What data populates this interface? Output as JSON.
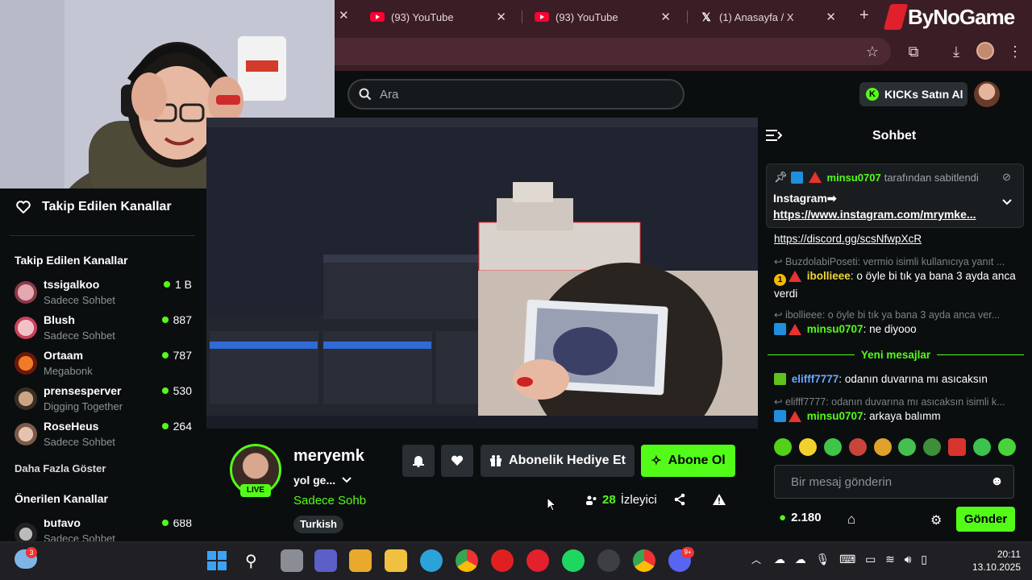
{
  "browser": {
    "tabs": [
      {
        "title": "(93) YouTube"
      },
      {
        "title": "(93) YouTube"
      },
      {
        "title": "(1) Anasayfa / X"
      }
    ],
    "brand_overlay": "ByNoGame"
  },
  "header": {
    "search_placeholder": "Ara",
    "kicks_button": "KICKs Satın Al"
  },
  "sidebar": {
    "followed_heading": "Takip Edilen Kanallar",
    "followed_section": "Takip Edilen Kanallar",
    "channels": [
      {
        "name": "tssigalkoo",
        "category": "Sadece Sohbet",
        "viewers": "1 B"
      },
      {
        "name": "Blush",
        "category": "Sadece Sohbet",
        "viewers": "887"
      },
      {
        "name": "Ortaam",
        "category": "Megabonk",
        "viewers": "787"
      },
      {
        "name": "prensesperver",
        "category": "Digging Together",
        "viewers": "530"
      },
      {
        "name": "RoseHeus",
        "category": "Sadece Sohbet",
        "viewers": "264"
      }
    ],
    "show_more": "Daha Fazla Göster",
    "recommended_section": "Önerilen Kanallar",
    "recommended": [
      {
        "name": "bufavo",
        "category": "Sadece Sohbet",
        "viewers": "688"
      }
    ]
  },
  "stream": {
    "streamer": "meryemk",
    "live_label": "LIVE",
    "title": "yol ge...",
    "category": "Sadece Sohb",
    "tag": "Turkish",
    "gift_label": "Abonelik Hediye Et",
    "subscribe_label": "Abone Ol",
    "viewer_count": "28",
    "viewer_label": "İzleyici"
  },
  "chat": {
    "title": "Sohbet",
    "pinned_by_user": "minsu0707",
    "pinned_by_text": "tarafından sabitlendi",
    "pinned_line1": "Instagram➡",
    "pinned_line2": "https://www.instagram.com/mrymke...",
    "link_line": "https://discord.gg/scsNfwpXcR",
    "messages": [
      {
        "reply": "BuzdolabiPoseti: vermio isimli kullanıcıya yanıt ..."
      },
      {
        "user": "ibollieee",
        "text": "o öyle bi tık ya bana 3 ayda anca verdi"
      },
      {
        "reply": "ibollieee: o öyle bi tık ya bana 3 ayda anca ver..."
      },
      {
        "user": "minsu0707",
        "text": "ne diyooo"
      },
      {
        "user": "elifff7777",
        "text": "odanın duvarına mı asıcaksın"
      },
      {
        "reply": "elifff7777: odanın duvarına mı asıcaksın isimli k..."
      },
      {
        "user": "minsu0707",
        "text": "arkaya balımm"
      }
    ],
    "new_messages": "Yeni mesajlar",
    "input_placeholder": "Bir mesaj gönderin",
    "points": "2.180",
    "send_label": "Gönder",
    "badge_number": "1"
  },
  "taskbar": {
    "weather_badge": "3",
    "discord_badge": "9+",
    "time": "20:11",
    "date": "13.10.2025"
  },
  "colors": {
    "accent": "#53fc18",
    "chrome": "#3a1d25",
    "bg": "#0b0e0f"
  }
}
